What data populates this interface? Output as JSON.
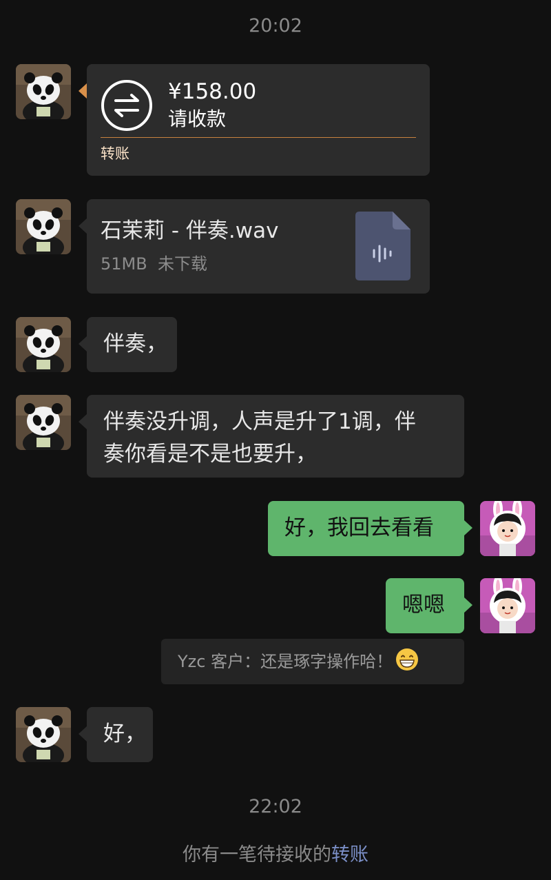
{
  "timestamps": [
    "20:02",
    "22:02"
  ],
  "transfer": {
    "amount": "¥158.00",
    "status": "请收款",
    "label": "转账",
    "icon": "transfer-arrows-icon"
  },
  "file_message": {
    "name": "石茉莉 - 伴奏.wav",
    "size": "51MB",
    "status": "未下载",
    "icon": "audio-file-icon"
  },
  "messages": [
    {
      "side": "in",
      "text": "伴奏，"
    },
    {
      "side": "in",
      "text_lines": [
        "伴奏没升调，人声是升了1调，伴",
        "奏你看是不是也要升，"
      ]
    },
    {
      "side": "out",
      "text": "好，我回去看看"
    },
    {
      "side": "out",
      "text": "嗯嗯"
    },
    {
      "side": "in",
      "text": "好，"
    }
  ],
  "quote": {
    "text": "Yzc 客户：还是琢字操作哈！",
    "emoji": "grinning-face-emoji"
  },
  "footer": {
    "prefix": "你有一笔待接收的",
    "link": "转账"
  },
  "colors": {
    "background": "#111111",
    "incoming_bubble": "#2c2c2c",
    "outgoing_bubble": "#5fb56c",
    "transfer_bubble": "#d9904a",
    "link": "#7b8fc7"
  },
  "avatars": {
    "contact": "panda-avatar",
    "self": "cartoon-girl-bunny-avatar"
  }
}
